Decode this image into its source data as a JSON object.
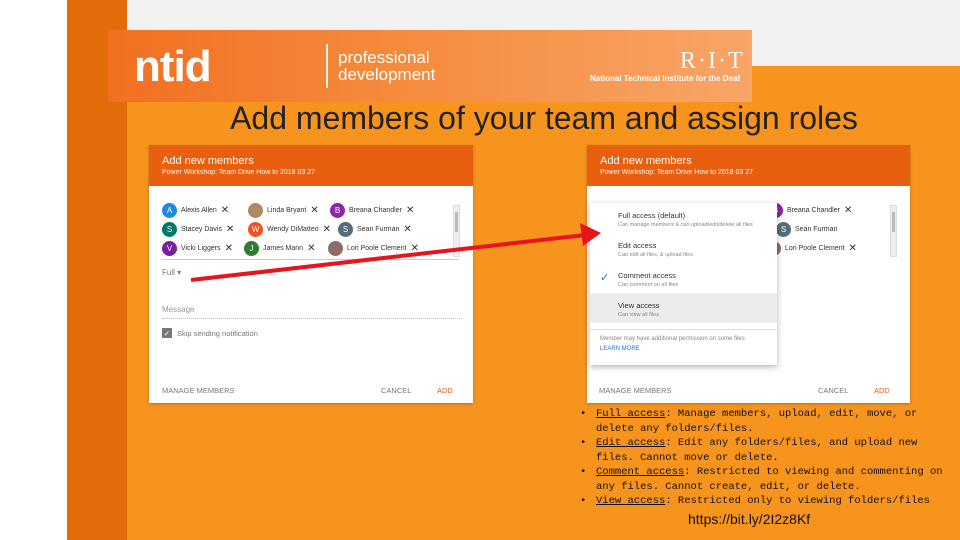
{
  "banner": {
    "logo": "ntid",
    "logo_sub": "professional development",
    "rit": "R·I·T",
    "rit_sub": "National Technical Institute for the Deaf"
  },
  "title": "Add members of your team and assign roles",
  "left_panel": {
    "heading": "Add new members",
    "subheading": "Power Workshop: Team Drive How to  2018 03 27",
    "chips": [
      {
        "initial": "A",
        "name": "Alexis Allen",
        "color": "#1e88e5"
      },
      {
        "initial": "",
        "name": "Linda Bryant",
        "color": "#b08968"
      },
      {
        "initial": "B",
        "name": "Breana Chandler",
        "color": "#8e24aa"
      },
      {
        "initial": "S",
        "name": "Stacey Davis",
        "color": "#00796b"
      },
      {
        "initial": "W",
        "name": "Wendy DiMatteo",
        "color": "#f4511e"
      },
      {
        "initial": "S",
        "name": "Sean Furman",
        "color": "#546e7a"
      },
      {
        "initial": "V",
        "name": "Vicki Liggers",
        "color": "#7b1fa2"
      },
      {
        "initial": "J",
        "name": "James Mann",
        "color": "#2e7d32"
      },
      {
        "initial": "",
        "name": "Lori Poole Clement",
        "color": "#8d6e63"
      }
    ],
    "role": "Full",
    "message_placeholder": "Message",
    "skip_label": "Skip sending notification",
    "manage": "MANAGE MEMBERS",
    "cancel": "CANCEL",
    "add": "ADD"
  },
  "right_panel": {
    "heading": "Add new members",
    "subheading": "Power Workshop: Team Drive How to  2018 03 27",
    "chips": [
      {
        "initial": "B",
        "name": "Breana Chandler",
        "color": "#8e24aa"
      },
      {
        "initial": "S",
        "name": "Sean Furman",
        "color": "#546e7a"
      },
      {
        "initial": "",
        "name": "Lori Poole Clement",
        "color": "#8d6e63"
      }
    ],
    "dropdown": [
      {
        "title": "Full access (default)",
        "desc": "Can manage members & can upload/edit/delete all files"
      },
      {
        "title": "Edit access",
        "desc": "Can edit all files, & upload files"
      },
      {
        "title": "Comment access",
        "desc": "Can comment on all files"
      },
      {
        "title": "View access",
        "desc": "Can view all files"
      }
    ],
    "note": "Member may have additional permission on some files",
    "learn_more": "LEARN MORE",
    "manage": "MANAGE MEMBERS",
    "cancel": "CANCEL",
    "add": "ADD"
  },
  "bullets": [
    {
      "term": "Full access",
      "text": ": Manage members, upload, edit, move, or delete any folders/files."
    },
    {
      "term": "Edit access",
      "text": ": Edit any folders/files, and upload new files. Cannot move or delete."
    },
    {
      "term": "Comment access",
      "text": ": Restricted to viewing and commenting on any files. Cannot create, edit, or delete."
    },
    {
      "term": "View access",
      "text": ": Restricted only to viewing folders/files"
    }
  ],
  "url": "https://bit.ly/2I2z8Kf",
  "colors": {
    "accent": "#f7941d",
    "dark": "#e36c0a",
    "header": "#e8600f",
    "arrow": "#e8141c"
  }
}
